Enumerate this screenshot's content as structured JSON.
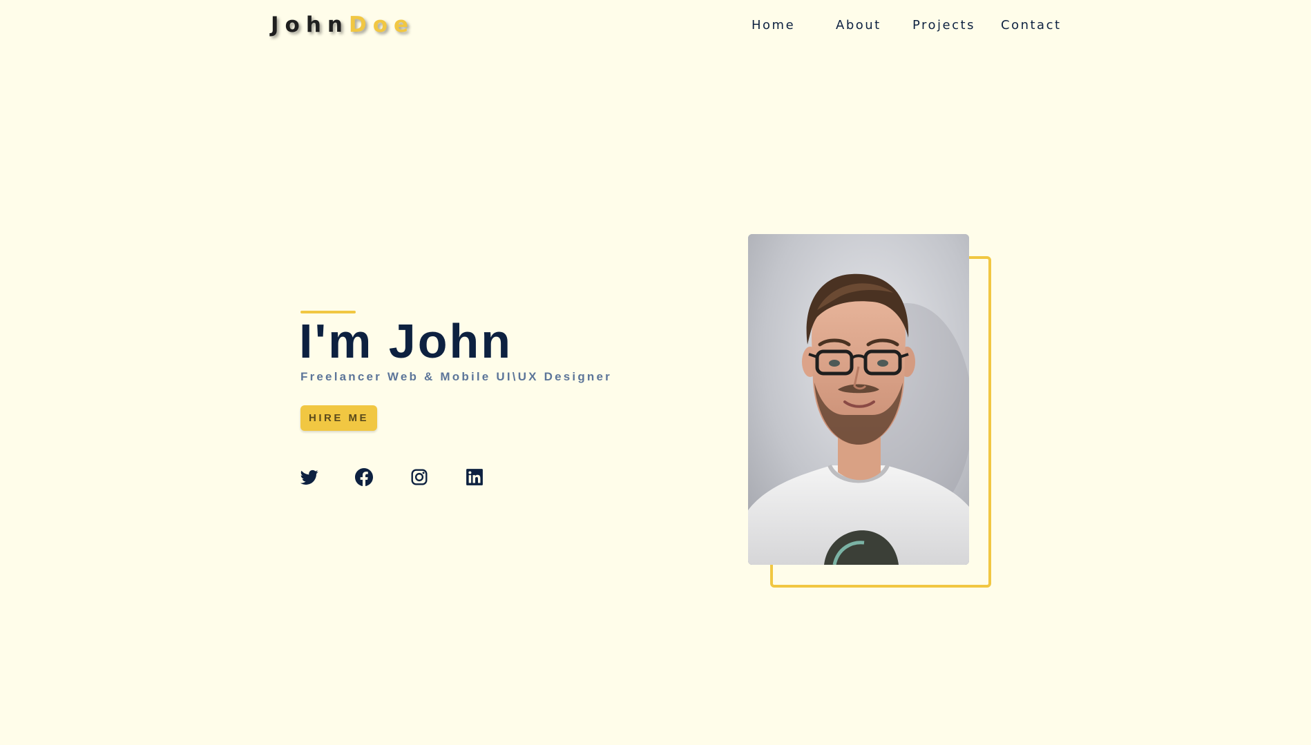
{
  "header": {
    "logo_first": "John",
    "logo_last": "Doe",
    "nav": [
      {
        "label": "Home"
      },
      {
        "label": "About"
      },
      {
        "label": "Projects"
      },
      {
        "label": "Contact"
      }
    ]
  },
  "hero": {
    "title": "I'm John",
    "subtitle": "Freelancer Web & Mobile UI\\UX Designer",
    "cta_label": "HIRE ME"
  },
  "socials": [
    {
      "icon": "twitter-icon"
    },
    {
      "icon": "facebook-icon"
    },
    {
      "icon": "instagram-icon"
    },
    {
      "icon": "linkedin-icon"
    }
  ],
  "colors": {
    "background": "#fffdea",
    "accent": "#f1c742",
    "navy": "#0d2140",
    "subtitle": "#5c7599"
  }
}
